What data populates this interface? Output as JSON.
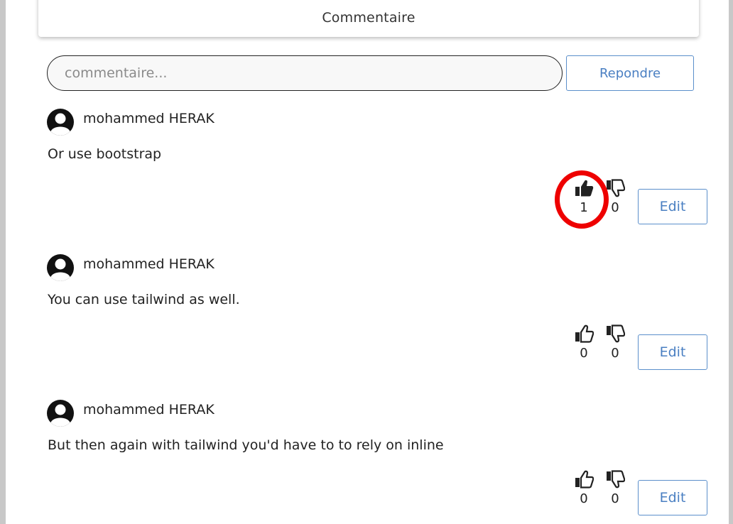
{
  "header": {
    "title": "Commentaire"
  },
  "composer": {
    "placeholder": "commentaire...",
    "reply_label": "Repondre"
  },
  "comments": [
    {
      "author": "mohammed HERAK",
      "text": "Or use bootstrap",
      "likes": "1",
      "dislikes": "0",
      "edit_label": "Edit",
      "liked": true
    },
    {
      "author": "mohammed HERAK",
      "text": "You can use tailwind as well.",
      "likes": "0",
      "dislikes": "0",
      "edit_label": "Edit",
      "liked": false
    },
    {
      "author": "mohammed HERAK",
      "text": "But then again with tailwind you'd have to to rely on inline",
      "likes": "0",
      "dislikes": "0",
      "edit_label": "Edit",
      "liked": false
    }
  ],
  "colors": {
    "accent": "#4a7fc2",
    "highlight": "#ee0000"
  },
  "icons": [
    "user-avatar-icon",
    "thumbs-up-icon",
    "thumbs-down-icon"
  ]
}
